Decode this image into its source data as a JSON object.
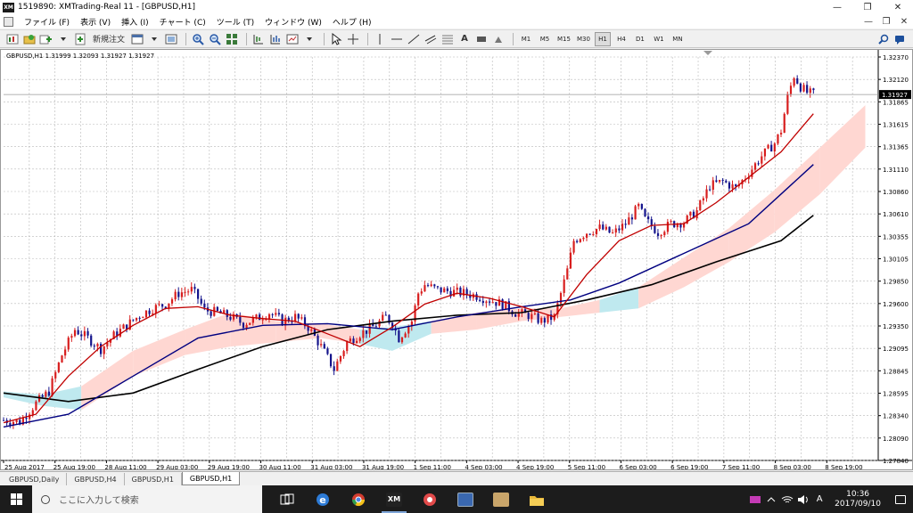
{
  "window": {
    "title": "1519890: XMTrading-Real 11 - [GBPUSD,H1]",
    "logo_text": "XM",
    "minimize": "—",
    "restore": "❐",
    "close": "✕"
  },
  "menu": {
    "items": [
      "ファイル (F)",
      "表示 (V)",
      "挿入 (I)",
      "チャート (C)",
      "ツール (T)",
      "ウィンドウ (W)",
      "ヘルプ (H)"
    ],
    "right_controls": [
      "—",
      "❐",
      "✕"
    ]
  },
  "toolbar": {
    "new_order_label": "新規注文",
    "timeframes": [
      "M1",
      "M5",
      "M15",
      "M30",
      "H1",
      "H4",
      "D1",
      "W1",
      "MN"
    ],
    "active_timeframe": "H1"
  },
  "chart": {
    "header": "GBPUSD,H1  1.31999 1.32093 1.31927 1.31927",
    "current_price_label": "1.31927",
    "colors": {
      "bull": "#d81e1e",
      "bear": "#14148c",
      "ma_fast": "#c00000",
      "ma_mid": "#000080",
      "ma_slow": "#000000",
      "cloud_bull": "#ffd7d2",
      "cloud_bear": "#bfe9ef",
      "grid": "#b8b8b8"
    }
  },
  "chart_data": {
    "type": "candlestick",
    "symbol": "GBPUSD",
    "timeframe": "H1",
    "ohlc_last": {
      "open": 1.31999,
      "high": 1.32093,
      "low": 1.31927,
      "close": 1.31927
    },
    "current_price": 1.31927,
    "ylim": [
      1.27604,
      1.3237
    ],
    "yticks": [
      "1.32370",
      "1.32120",
      "1.31865",
      "1.31615",
      "1.31365",
      "1.31110",
      "1.30860",
      "1.30610",
      "1.30355",
      "1.30105",
      "1.29850",
      "1.29600",
      "1.29350",
      "1.29095",
      "1.28845",
      "1.28595",
      "1.28340",
      "1.28090",
      "1.27840"
    ],
    "xticks": [
      "25 Aug 2017",
      "25 Aug 19:00",
      "28 Aug 11:00",
      "29 Aug 03:00",
      "29 Aug 19:00",
      "30 Aug 11:00",
      "31 Aug 03:00",
      "31 Aug 19:00",
      "1 Sep 11:00",
      "4 Sep 03:00",
      "4 Sep 19:00",
      "5 Sep 11:00",
      "6 Sep 03:00",
      "6 Sep 19:00",
      "7 Sep 11:00",
      "8 Sep 03:00",
      "8 Sep 19:00"
    ],
    "close_path": [
      [
        0,
        1.2808
      ],
      [
        5,
        1.2806
      ],
      [
        10,
        1.2828
      ],
      [
        14,
        1.2842
      ],
      [
        18,
        1.2885
      ],
      [
        22,
        1.2915
      ],
      [
        26,
        1.2905
      ],
      [
        30,
        1.2892
      ],
      [
        34,
        1.2908
      ],
      [
        38,
        1.292
      ],
      [
        42,
        1.2932
      ],
      [
        46,
        1.294
      ],
      [
        50,
        1.2945
      ],
      [
        54,
        1.2958
      ],
      [
        58,
        1.2962
      ],
      [
        60,
        1.2952
      ],
      [
        62,
        1.2938
      ],
      [
        66,
        1.2935
      ],
      [
        70,
        1.293
      ],
      [
        74,
        1.2922
      ],
      [
        78,
        1.2928
      ],
      [
        82,
        1.2935
      ],
      [
        86,
        1.2925
      ],
      [
        90,
        1.293
      ],
      [
        94,
        1.2918
      ],
      [
        98,
        1.2895
      ],
      [
        102,
        1.2868
      ],
      [
        106,
        1.29
      ],
      [
        110,
        1.291
      ],
      [
        114,
        1.2918
      ],
      [
        118,
        1.293
      ],
      [
        120,
        1.2922
      ],
      [
        122,
        1.2905
      ],
      [
        124,
        1.2915
      ],
      [
        126,
        1.2925
      ],
      [
        128,
        1.2958
      ],
      [
        130,
        1.2968
      ],
      [
        134,
        1.2962
      ],
      [
        138,
        1.296
      ],
      [
        142,
        1.2958
      ],
      [
        146,
        1.2955
      ],
      [
        150,
        1.295
      ],
      [
        154,
        1.2945
      ],
      [
        158,
        1.2935
      ],
      [
        162,
        1.2932
      ],
      [
        166,
        1.2925
      ],
      [
        170,
        1.293
      ],
      [
        174,
        1.2985
      ],
      [
        176,
        1.302
      ],
      [
        180,
        1.303
      ],
      [
        184,
        1.3035
      ],
      [
        188,
        1.3028
      ],
      [
        192,
        1.304
      ],
      [
        196,
        1.306
      ],
      [
        198,
        1.3045
      ],
      [
        202,
        1.303
      ],
      [
        206,
        1.304
      ],
      [
        210,
        1.3042
      ],
      [
        214,
        1.3055
      ],
      [
        218,
        1.3085
      ],
      [
        222,
        1.309
      ],
      [
        226,
        1.3082
      ],
      [
        230,
        1.31
      ],
      [
        234,
        1.312
      ],
      [
        238,
        1.3135
      ],
      [
        240,
        1.315
      ],
      [
        242,
        1.319
      ],
      [
        244,
        1.3215
      ],
      [
        246,
        1.3202
      ],
      [
        248,
        1.3195
      ],
      [
        250,
        1.3193
      ]
    ],
    "ma_fast": [
      [
        0,
        1.2805
      ],
      [
        10,
        1.2815
      ],
      [
        20,
        1.286
      ],
      [
        30,
        1.2895
      ],
      [
        40,
        1.292
      ],
      [
        50,
        1.294
      ],
      [
        60,
        1.2942
      ],
      [
        70,
        1.2932
      ],
      [
        80,
        1.2928
      ],
      [
        90,
        1.2925
      ],
      [
        100,
        1.291
      ],
      [
        110,
        1.2895
      ],
      [
        120,
        1.2918
      ],
      [
        130,
        1.2945
      ],
      [
        140,
        1.2958
      ],
      [
        150,
        1.2952
      ],
      [
        160,
        1.2942
      ],
      [
        170,
        1.293
      ],
      [
        180,
        1.298
      ],
      [
        190,
        1.302
      ],
      [
        200,
        1.3038
      ],
      [
        210,
        1.304
      ],
      [
        220,
        1.3065
      ],
      [
        230,
        1.3095
      ],
      [
        240,
        1.3125
      ],
      [
        250,
        1.317
      ]
    ],
    "ma_mid": [
      [
        0,
        1.28
      ],
      [
        20,
        1.2815
      ],
      [
        40,
        1.286
      ],
      [
        60,
        1.2905
      ],
      [
        80,
        1.292
      ],
      [
        100,
        1.2922
      ],
      [
        120,
        1.2915
      ],
      [
        140,
        1.293
      ],
      [
        160,
        1.2942
      ],
      [
        175,
        1.295
      ],
      [
        190,
        1.297
      ],
      [
        210,
        1.3005
      ],
      [
        230,
        1.304
      ],
      [
        250,
        1.311
      ]
    ],
    "ma_slow": [
      [
        0,
        1.284
      ],
      [
        20,
        1.283
      ],
      [
        40,
        1.284
      ],
      [
        60,
        1.2868
      ],
      [
        80,
        1.2895
      ],
      [
        100,
        1.2915
      ],
      [
        120,
        1.2925
      ],
      [
        140,
        1.2932
      ],
      [
        160,
        1.2935
      ],
      [
        180,
        1.295
      ],
      [
        200,
        1.2968
      ],
      [
        220,
        1.2995
      ],
      [
        240,
        1.302
      ],
      [
        250,
        1.305
      ]
    ],
    "cloud": [
      [
        0,
        1.2835,
        1.2842,
        "bear"
      ],
      [
        12,
        1.2825,
        1.2838,
        "bear"
      ],
      [
        24,
        1.282,
        1.2848,
        "bull"
      ],
      [
        40,
        1.286,
        1.289,
        "bull"
      ],
      [
        56,
        1.2885,
        1.2915,
        "bull"
      ],
      [
        70,
        1.2895,
        1.2935,
        "bull"
      ],
      [
        84,
        1.29,
        1.2925,
        "bull"
      ],
      [
        98,
        1.2905,
        1.2922,
        "bull"
      ],
      [
        110,
        1.2898,
        1.2915,
        "bear"
      ],
      [
        120,
        1.289,
        1.2918,
        "bear"
      ],
      [
        132,
        1.291,
        1.2925,
        "bull"
      ],
      [
        146,
        1.2915,
        1.2935,
        "bull"
      ],
      [
        160,
        1.2925,
        1.294,
        "bull"
      ],
      [
        172,
        1.293,
        1.294,
        "bull"
      ],
      [
        184,
        1.2935,
        1.295,
        "bear"
      ],
      [
        196,
        1.294,
        1.2965,
        "bull"
      ],
      [
        210,
        1.2965,
        1.3,
        "bull"
      ],
      [
        224,
        1.2995,
        1.3035,
        "bull"
      ],
      [
        238,
        1.303,
        1.308,
        "bull"
      ],
      [
        252,
        1.3075,
        1.313,
        "bull"
      ],
      [
        266,
        1.313,
        1.318,
        "bull"
      ]
    ]
  },
  "tabs": [
    "GBPUSD,Daily",
    "GBPUSD,H4",
    "GBPUSD,H1",
    "GBPUSD,H1"
  ],
  "active_tab_index": 3,
  "taskbar": {
    "search_placeholder": "ここに入力して検索",
    "apps": [
      "task-view",
      "edge",
      "chrome",
      "xm-trader",
      "app-red",
      "app-blue",
      "app-tan",
      "file-explorer"
    ],
    "ime": "A",
    "time": "10:36",
    "date": "2017/09/10"
  }
}
